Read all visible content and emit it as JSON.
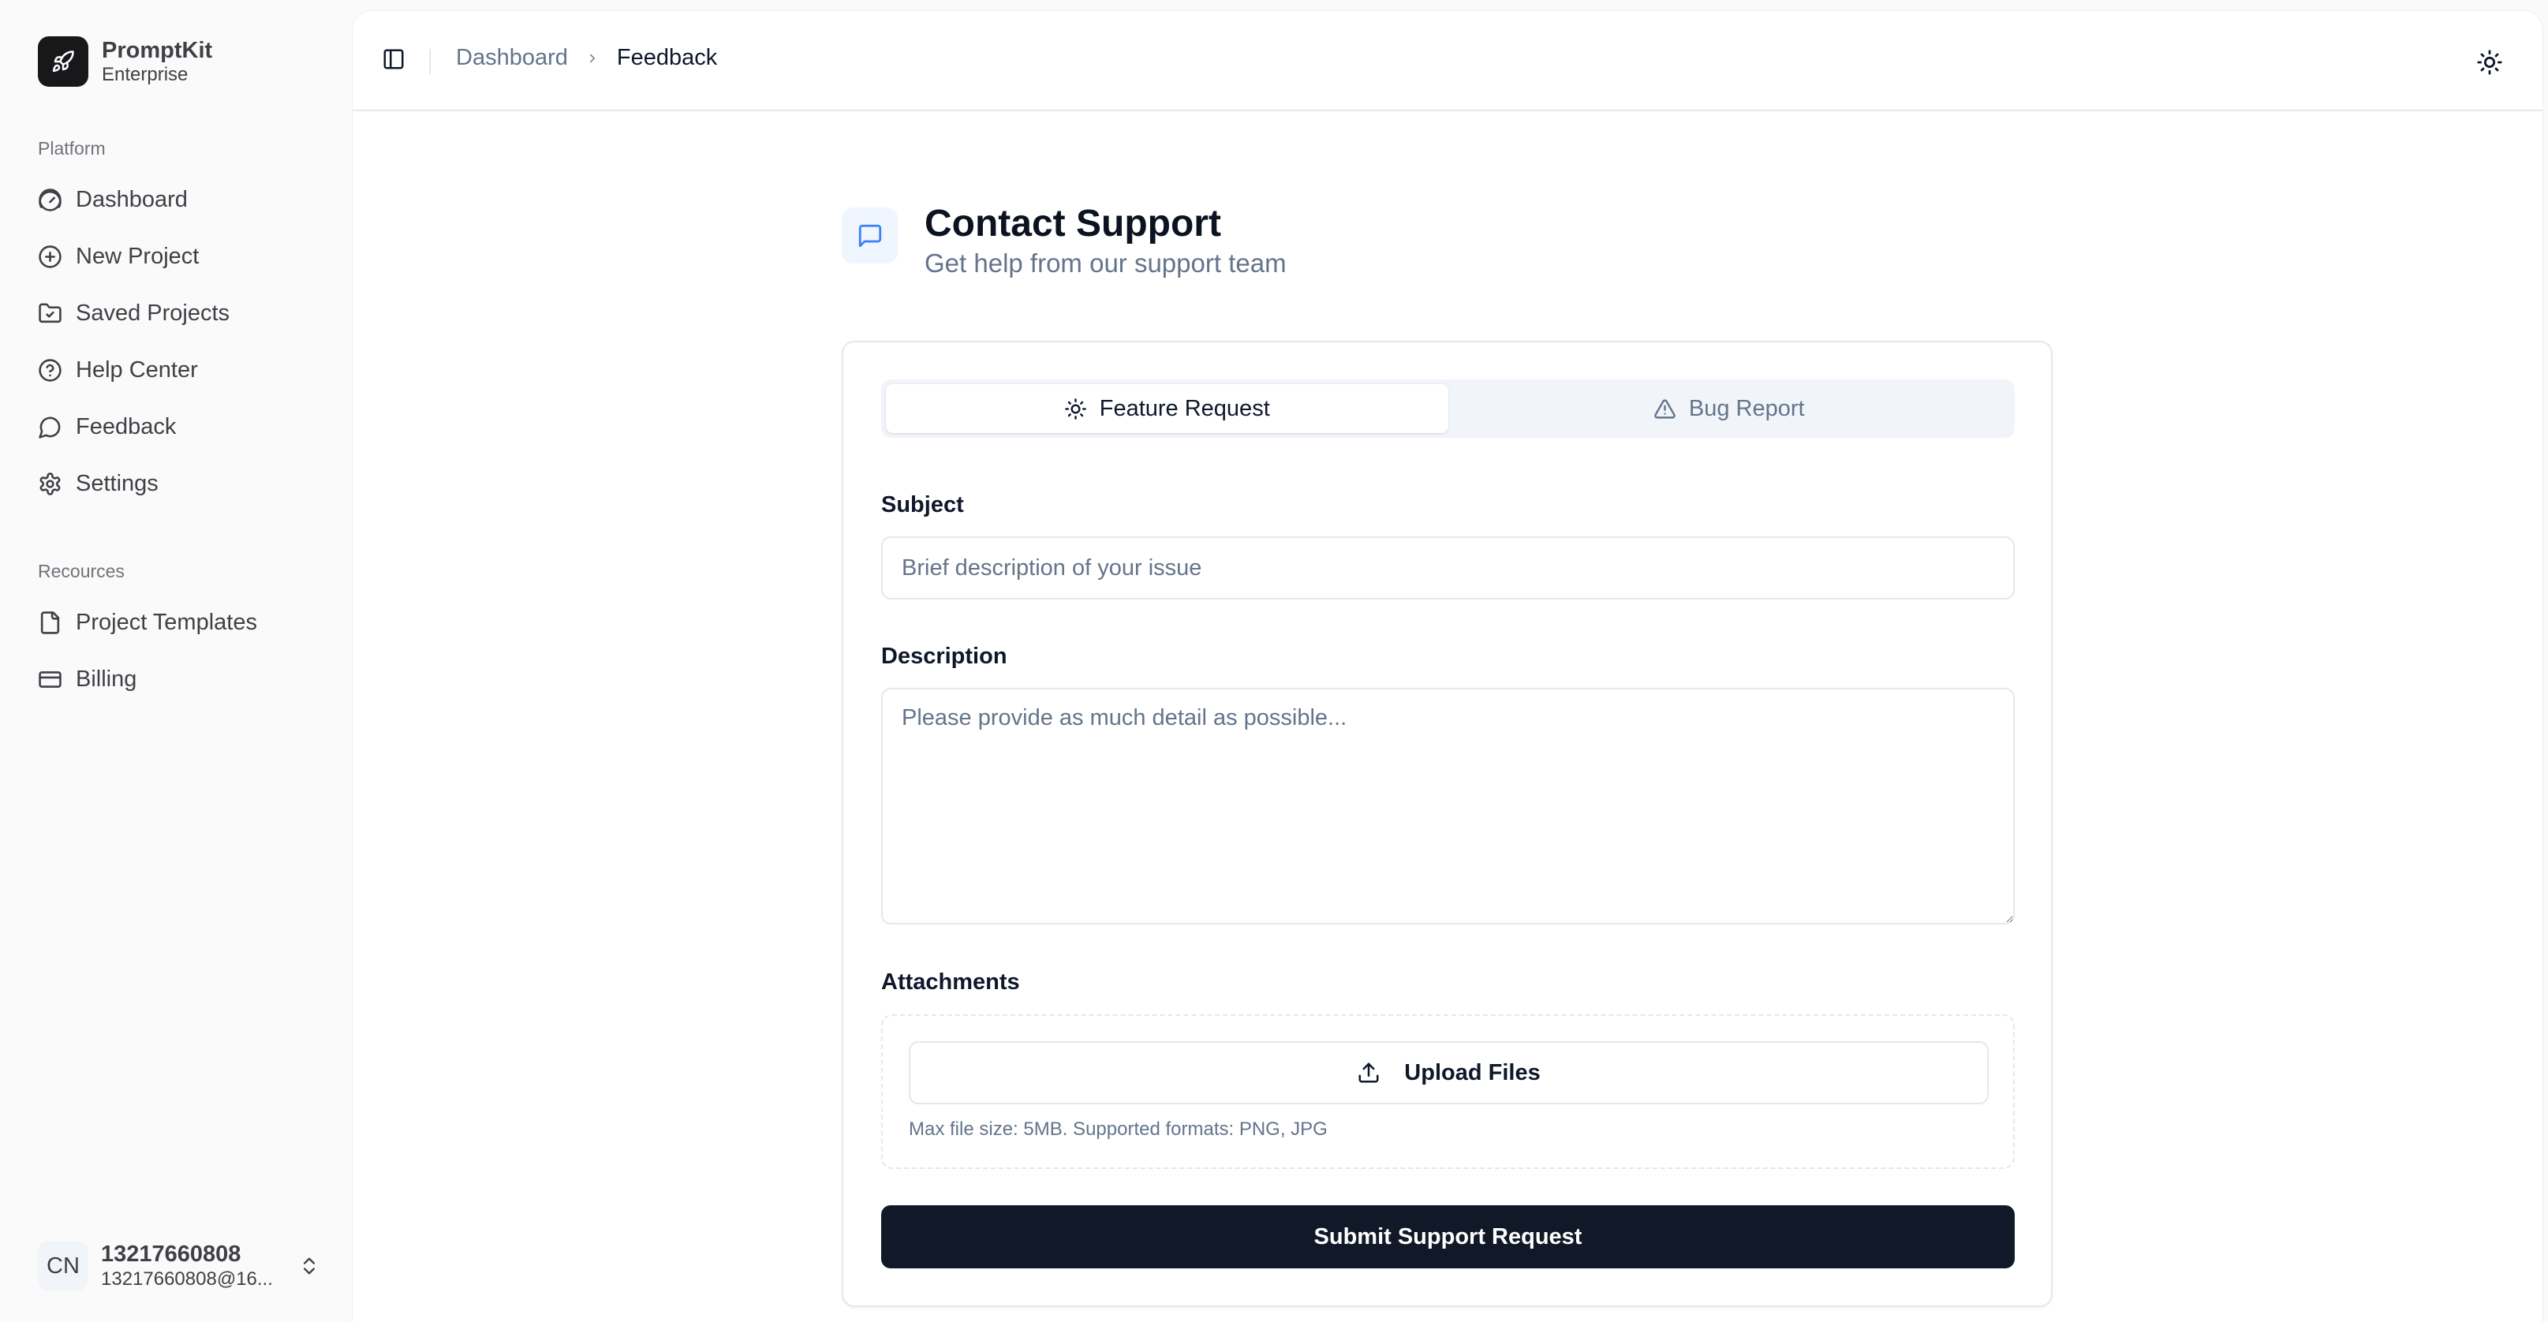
{
  "brand": {
    "name": "PromptKit",
    "subtitle": "Enterprise",
    "icon": "rocket-icon"
  },
  "sidebar": {
    "groups": [
      {
        "label": "Platform",
        "items": [
          {
            "label": "Dashboard",
            "icon": "gauge-icon"
          },
          {
            "label": "New Project",
            "icon": "plus-circle-icon"
          },
          {
            "label": "Saved Projects",
            "icon": "folder-check-icon"
          },
          {
            "label": "Help Center",
            "icon": "help-circle-icon"
          },
          {
            "label": "Feedback",
            "icon": "message-circle-icon"
          },
          {
            "label": "Settings",
            "icon": "gear-icon"
          }
        ]
      },
      {
        "label": "Recources",
        "items": [
          {
            "label": "Project Templates",
            "icon": "file-icon"
          },
          {
            "label": "Billing",
            "icon": "credit-card-icon"
          }
        ]
      }
    ]
  },
  "user": {
    "initials": "CN",
    "name": "13217660808",
    "email": "13217660808@16..."
  },
  "header": {
    "breadcrumb": [
      {
        "label": "Dashboard"
      },
      {
        "label": "Feedback"
      }
    ]
  },
  "page": {
    "title": "Contact Support",
    "subtitle": "Get help from our support team"
  },
  "form": {
    "tabs": [
      {
        "label": "Feature Request",
        "icon": "sun-icon",
        "active": true
      },
      {
        "label": "Bug Report",
        "icon": "alert-triangle-icon",
        "active": false
      }
    ],
    "subject": {
      "label": "Subject",
      "value": "",
      "placeholder": "Brief description of your issue"
    },
    "description": {
      "label": "Description",
      "value": "",
      "placeholder": "Please provide as much detail as possible..."
    },
    "attachments": {
      "label": "Attachments",
      "upload_label": "Upload Files",
      "hint": "Max file size: 5MB. Supported formats: PNG, JPG"
    },
    "submit_label": "Submit Support Request"
  },
  "colors": {
    "primary_button": "#111827",
    "accent_icon": "#3b82f6",
    "muted_text": "#64748b"
  }
}
